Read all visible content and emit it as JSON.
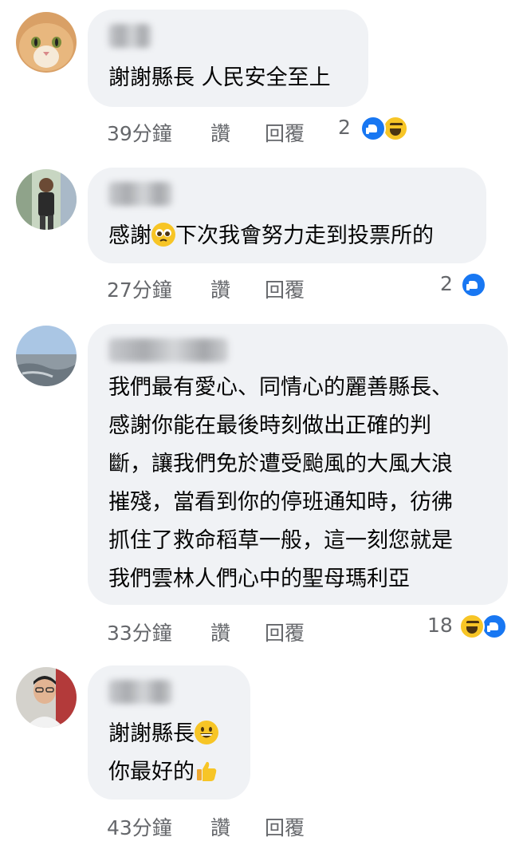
{
  "comments": [
    {
      "text": "謝謝縣長 人民安全至上",
      "time": "39分鐘",
      "like": "讚",
      "reply": "回覆",
      "reactions_count": "2",
      "reactions": [
        "like-icon",
        "haha-icon"
      ]
    },
    {
      "text_before_emoji": "感謝",
      "emoji": "pleading-face-emoji",
      "text_after_emoji": "下次我會努力走到投票所的",
      "time": "27分鐘",
      "like": "讚",
      "reply": "回覆",
      "reactions_count": "2",
      "reactions": [
        "like-icon"
      ]
    },
    {
      "lines": [
        "我們最有愛心、同情心的麗善縣長、",
        "感謝你能在最後時刻做出正確的判",
        "斷，讓我們免於遭受颱風的大風大浪",
        "摧殘，當看到你的停班通知時，彷彿",
        "抓住了救命稻草一般，這一刻您就是",
        "我們雲林人們心中的聖母瑪利亞"
      ],
      "time": "33分鐘",
      "like": "讚",
      "reply": "回覆",
      "reactions_count": "18",
      "reactions": [
        "haha-icon",
        "like-icon"
      ]
    },
    {
      "line1": "謝謝縣長",
      "emoji1": "grinning-face-emoji",
      "line2": "你最好的",
      "emoji2": "thumbs-up-emoji",
      "time": "43分鐘",
      "like": "讚",
      "reply": "回覆"
    }
  ],
  "colors": {
    "bubble": "#f0f2f5",
    "meta_text": "#65676b",
    "like_blue": "#1877f2",
    "haha_yellow": "#f7c526"
  }
}
